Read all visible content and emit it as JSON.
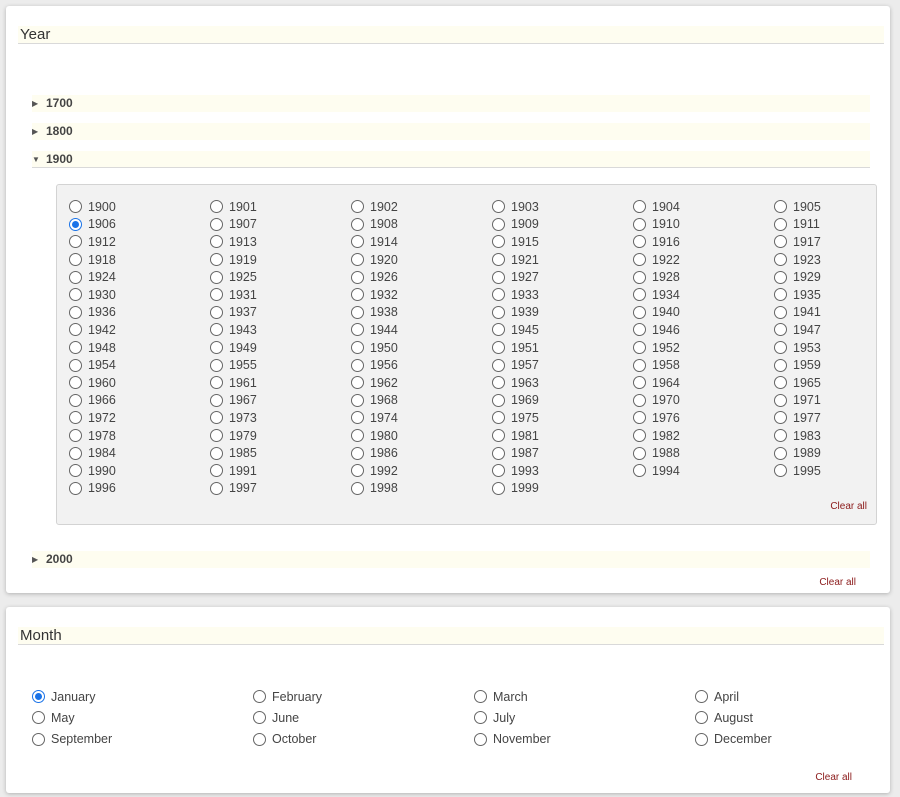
{
  "year_section": {
    "title": "Year",
    "clear_all": "Clear all",
    "decades": [
      {
        "label": "1700",
        "expanded": false
      },
      {
        "label": "1800",
        "expanded": false
      },
      {
        "label": "1900",
        "expanded": true
      },
      {
        "label": "2000",
        "expanded": false
      }
    ],
    "panel": {
      "clear_all": "Clear all",
      "selected": "1906",
      "years": [
        "1900",
        "1901",
        "1902",
        "1903",
        "1904",
        "1905",
        "1906",
        "1907",
        "1908",
        "1909",
        "1910",
        "1911",
        "1912",
        "1913",
        "1914",
        "1915",
        "1916",
        "1917",
        "1918",
        "1919",
        "1920",
        "1921",
        "1922",
        "1923",
        "1924",
        "1925",
        "1926",
        "1927",
        "1928",
        "1929",
        "1930",
        "1931",
        "1932",
        "1933",
        "1934",
        "1935",
        "1936",
        "1937",
        "1938",
        "1939",
        "1940",
        "1941",
        "1942",
        "1943",
        "1944",
        "1945",
        "1946",
        "1947",
        "1948",
        "1949",
        "1950",
        "1951",
        "1952",
        "1953",
        "1954",
        "1955",
        "1956",
        "1957",
        "1958",
        "1959",
        "1960",
        "1961",
        "1962",
        "1963",
        "1964",
        "1965",
        "1966",
        "1967",
        "1968",
        "1969",
        "1970",
        "1971",
        "1972",
        "1973",
        "1974",
        "1975",
        "1976",
        "1977",
        "1978",
        "1979",
        "1980",
        "1981",
        "1982",
        "1983",
        "1984",
        "1985",
        "1986",
        "1987",
        "1988",
        "1989",
        "1990",
        "1991",
        "1992",
        "1993",
        "1994",
        "1995",
        "1996",
        "1997",
        "1998",
        "1999"
      ]
    }
  },
  "month_section": {
    "title": "Month",
    "clear_all": "Clear all",
    "selected": "January",
    "months": [
      "January",
      "February",
      "March",
      "April",
      "May",
      "June",
      "July",
      "August",
      "September",
      "October",
      "November",
      "December"
    ]
  },
  "colors": {
    "accent": "#1a73e8",
    "header_bg": "#fefdf0",
    "panel_bg": "#f2f2f2",
    "link": "#8b1a1a"
  }
}
